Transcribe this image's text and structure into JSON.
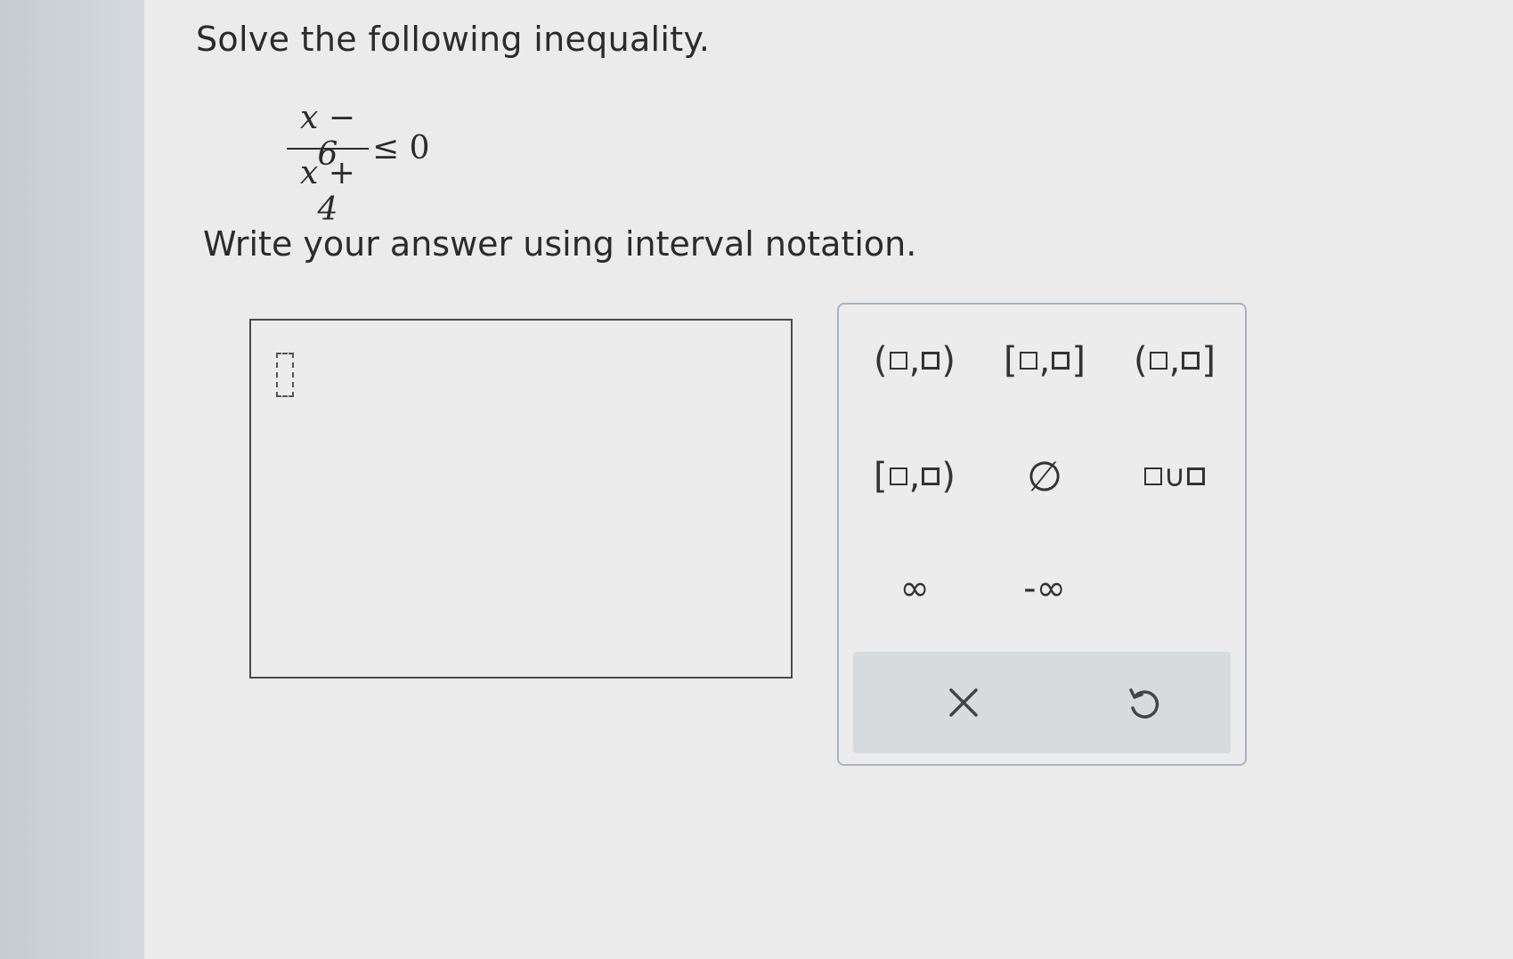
{
  "question": {
    "prompt": "Solve the following inequality.",
    "numerator": "x − 6",
    "denominator": "x + 4",
    "relation": "≤ 0",
    "instruction": "Write your answer using interval notation."
  },
  "answer": {
    "value": ""
  },
  "keypad": {
    "row1": [
      {
        "open": "(",
        "close": ")"
      },
      {
        "open": "[",
        "close": "]"
      },
      {
        "open": "(",
        "close": "]"
      }
    ],
    "row2": [
      {
        "open": "[",
        "close": ")"
      }
    ],
    "empty_set": "∅",
    "union_symbol": "∪",
    "infinity": "∞",
    "neg_infinity": "-∞",
    "comma": ","
  },
  "icons": {
    "clear": "close-icon",
    "undo": "undo-icon"
  }
}
